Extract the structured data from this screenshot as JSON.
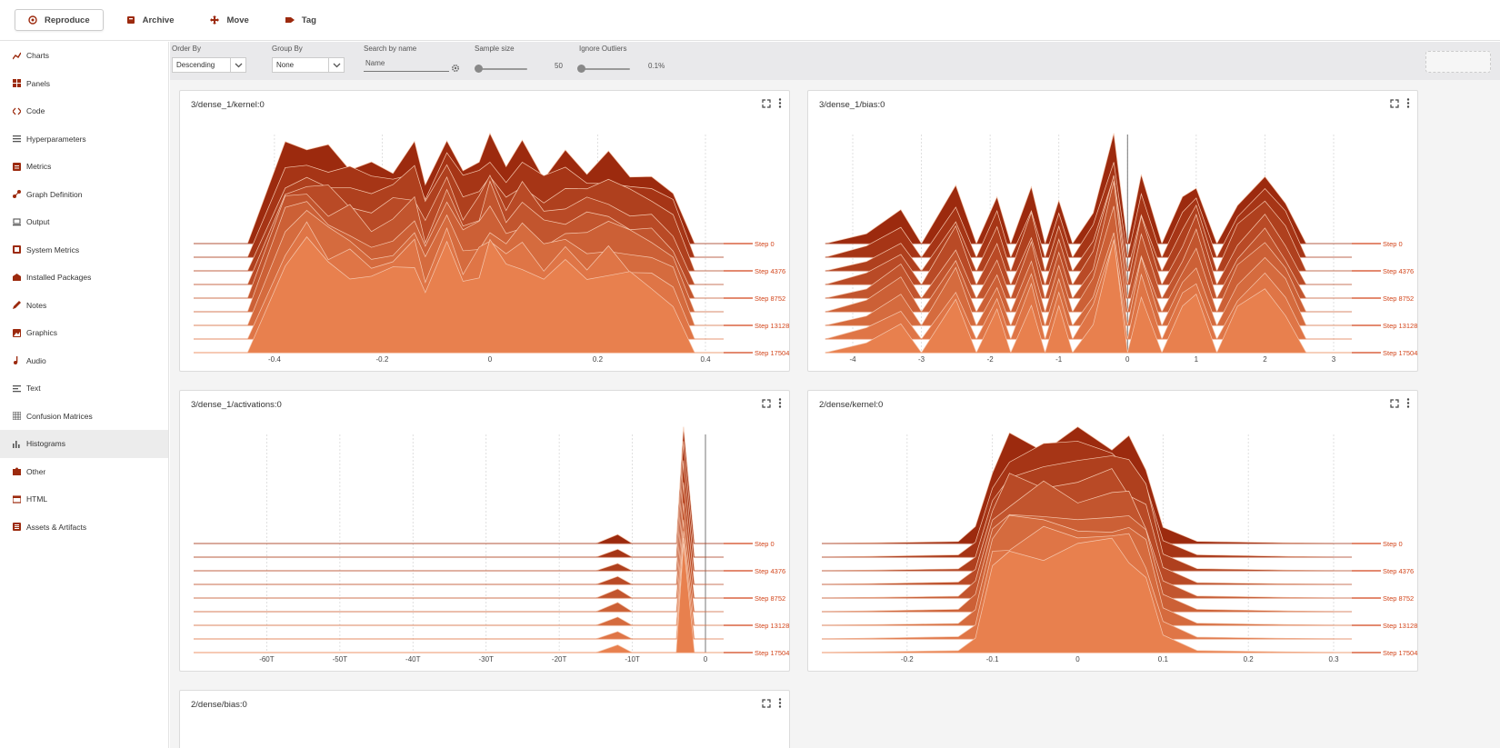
{
  "toolbar": {
    "buttons": [
      {
        "label": "Reproduce",
        "icon": "reproduce-icon"
      },
      {
        "label": "Archive",
        "icon": "archive-icon"
      },
      {
        "label": "Move",
        "icon": "move-icon"
      },
      {
        "label": "Tag",
        "icon": "tag-icon"
      }
    ]
  },
  "sidebar": {
    "items": [
      {
        "label": "Charts",
        "icon": "line-chart-icon"
      },
      {
        "label": "Panels",
        "icon": "panels-icon"
      },
      {
        "label": "Code",
        "icon": "code-icon"
      },
      {
        "label": "Hyperparameters",
        "icon": "list-icon"
      },
      {
        "label": "Metrics",
        "icon": "metrics-icon"
      },
      {
        "label": "Graph Definition",
        "icon": "graph-icon"
      },
      {
        "label": "Output",
        "icon": "laptop-icon"
      },
      {
        "label": "System Metrics",
        "icon": "system-icon"
      },
      {
        "label": "Installed Packages",
        "icon": "packages-icon"
      },
      {
        "label": "Notes",
        "icon": "pencil-icon"
      },
      {
        "label": "Graphics",
        "icon": "image-icon"
      },
      {
        "label": "Audio",
        "icon": "music-icon"
      },
      {
        "label": "Text",
        "icon": "text-icon"
      },
      {
        "label": "Confusion Matrices",
        "icon": "grid-icon"
      },
      {
        "label": "Histograms",
        "icon": "histogram-icon",
        "active": true
      },
      {
        "label": "Other",
        "icon": "puzzle-icon"
      },
      {
        "label": "HTML",
        "icon": "html-icon"
      },
      {
        "label": "Assets & Artifacts",
        "icon": "assets-icon"
      }
    ]
  },
  "filters": {
    "order_by": {
      "label": "Order By",
      "value": "Descending"
    },
    "group_by": {
      "label": "Group By",
      "value": "None"
    },
    "search": {
      "label": "Search by name",
      "placeholder": "Name"
    },
    "sample_size": {
      "label": "Sample size",
      "value": "50",
      "fraction": 0.05
    },
    "ignore_outliers": {
      "label": "Ignore Outliers",
      "value": "0.1%",
      "fraction": 0.02
    }
  },
  "colors": {
    "dark": "#9c2a0e",
    "light": "#e8804e",
    "label": "#d2441a",
    "grid": "#d8d8d8"
  },
  "chart_data": [
    {
      "type": "area",
      "title": "3/dense_1/kernel:0",
      "xlim": [
        -0.55,
        0.4
      ],
      "x_ticks": [
        "-0.4",
        "-0.2",
        "0",
        "0.2",
        "0.4"
      ],
      "x_tick_values": [
        -0.4,
        -0.2,
        0,
        0.2,
        0.4
      ],
      "steps": [
        "Step 0",
        "Step 4376",
        "Step 8752",
        "Step 13128",
        "Step 17504"
      ],
      "x": [
        -0.55,
        -0.45,
        -0.38,
        -0.34,
        -0.3,
        -0.26,
        -0.22,
        -0.18,
        -0.14,
        -0.12,
        -0.08,
        -0.05,
        -0.02,
        0,
        0.03,
        0.06,
        0.1,
        0.14,
        0.18,
        0.22,
        0.26,
        0.3,
        0.34,
        0.38
      ],
      "values": [
        0,
        0,
        0.9,
        1,
        0.85,
        0.8,
        0.7,
        0.75,
        0.9,
        0.6,
        0.95,
        0.7,
        0.8,
        1,
        0.8,
        0.9,
        0.7,
        0.8,
        0.75,
        0.8,
        0.7,
        0.6,
        0.5,
        0
      ],
      "n_ridges": 9
    },
    {
      "type": "area",
      "title": "3/dense_1/bias:0",
      "xlim": [
        -4.45,
        3
      ],
      "x_ticks": [
        "-4",
        "-3",
        "-2",
        "-1",
        "0",
        "1",
        "2",
        "3"
      ],
      "x_tick_values": [
        -4,
        -3,
        -2,
        -1,
        0,
        1,
        2,
        3
      ],
      "steps": [
        "Step 0",
        "Step 4376",
        "Step 8752",
        "Step 13128",
        "Step 17504"
      ],
      "x": [
        -4.4,
        -3.8,
        -3.3,
        -3,
        -2.5,
        -2.2,
        -1.9,
        -1.7,
        -1.4,
        -1.2,
        -1,
        -0.8,
        -0.5,
        -0.2,
        0,
        0.2,
        0.5,
        0.8,
        1,
        1.3,
        1.6,
        2,
        2.3,
        2.6
      ],
      "values": [
        0,
        0.1,
        0.3,
        0,
        0.5,
        0,
        0.4,
        0,
        0.5,
        0,
        0.4,
        0,
        0.3,
        1,
        0,
        0.6,
        0,
        0.4,
        0.6,
        0,
        0.4,
        0.6,
        0.4,
        0
      ],
      "n_ridges": 9
    },
    {
      "type": "area",
      "title": "3/dense_1/activations:0",
      "xlim": [
        -70,
        0
      ],
      "x_ticks": [
        "-60T",
        "-50T",
        "-40T",
        "-30T",
        "-20T",
        "-10T",
        "0"
      ],
      "x_tick_values": [
        -60,
        -50,
        -40,
        -30,
        -20,
        -10,
        0
      ],
      "steps": [
        "Step 0",
        "Step 4376",
        "Step 8752",
        "Step 13128",
        "Step 17504"
      ],
      "x": [
        -70,
        -15,
        -12,
        -10,
        -6,
        -4,
        -3,
        -1.5,
        -0.5,
        0
      ],
      "values": [
        0,
        0,
        0.08,
        0,
        0,
        0,
        1,
        0,
        0,
        0
      ],
      "n_ridges": 9
    },
    {
      "type": "area",
      "title": "2/dense/kernel:0",
      "xlim": [
        -0.3,
        0.3
      ],
      "x_ticks": [
        "-0.2",
        "-0.1",
        "0",
        "0.1",
        "0.2",
        "0.3"
      ],
      "x_tick_values": [
        -0.2,
        -0.1,
        0,
        0.1,
        0.2,
        0.3
      ],
      "steps": [
        "Step 0",
        "Step 4376",
        "Step 8752",
        "Step 13128",
        "Step 17504"
      ],
      "x": [
        -0.3,
        -0.14,
        -0.12,
        -0.1,
        -0.08,
        -0.04,
        0,
        0.04,
        0.06,
        0.08,
        0.1,
        0.14,
        0.3
      ],
      "values": [
        0,
        0.02,
        0.15,
        0.75,
        0.95,
        1,
        1,
        1,
        0.95,
        0.75,
        0.15,
        0.02,
        0
      ],
      "n_ridges": 9
    },
    {
      "type": "area",
      "title": "2/dense/bias:0"
    }
  ]
}
